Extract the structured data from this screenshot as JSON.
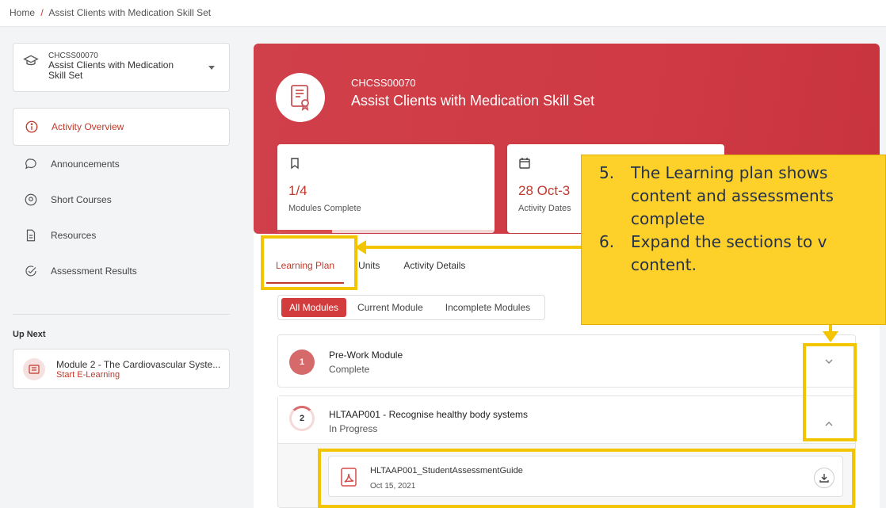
{
  "breadcrumb": {
    "home": "Home",
    "separator": "/",
    "current": "Assist Clients with Medication Skill Set"
  },
  "course_selector": {
    "code": "CHCSS00070",
    "name": "Assist Clients with Medication Skill Set"
  },
  "nav": [
    {
      "label": "Activity Overview",
      "icon": "info-icon",
      "active": true
    },
    {
      "label": "Announcements",
      "icon": "chat-bubble-icon"
    },
    {
      "label": "Short Courses",
      "icon": "location-pin-icon"
    },
    {
      "label": "Resources",
      "icon": "document-icon"
    },
    {
      "label": "Assessment Results",
      "icon": "check-circle-icon"
    }
  ],
  "up_next": {
    "label": "Up Next",
    "title": "Module 2 - The Cardiovascular Syste...",
    "action": "Start E-Learning"
  },
  "hero": {
    "code": "CHCSS00070",
    "title": "Assist Clients with Medication Skill Set"
  },
  "stats": {
    "modules": {
      "value": "1/4",
      "label": "Modules Complete",
      "progress": 0.25
    },
    "dates": {
      "value": "28 Oct-3",
      "label": "Activity Dates"
    }
  },
  "tabs": [
    "Learning Plan",
    "Units",
    "Activity Details"
  ],
  "filters": [
    "All Modules",
    "Current Module",
    "Incomplete Modules"
  ],
  "modules": [
    {
      "number": "1",
      "title": "Pre-Work Module",
      "status": "Complete"
    },
    {
      "number": "2",
      "title": "HLTAAP001 - Recognise healthy body systems",
      "status": "In Progress"
    }
  ],
  "file": {
    "name": "HLTAAP001_StudentAssessmentGuide",
    "date": "Oct 15, 2021"
  },
  "callout": {
    "item5_num": "5.",
    "item5_line1": "The Learning plan shows",
    "item5_line2": "content and assessments",
    "item5_line3": "complete",
    "item6_num": "6.",
    "item6_line1": "Expand the sections to v",
    "item6_line2": "content."
  },
  "colors": {
    "accent": "#c0392b",
    "hero": "#cf3a44",
    "highlight": "#f2c500",
    "callout_bg": "#fdd12a"
  }
}
